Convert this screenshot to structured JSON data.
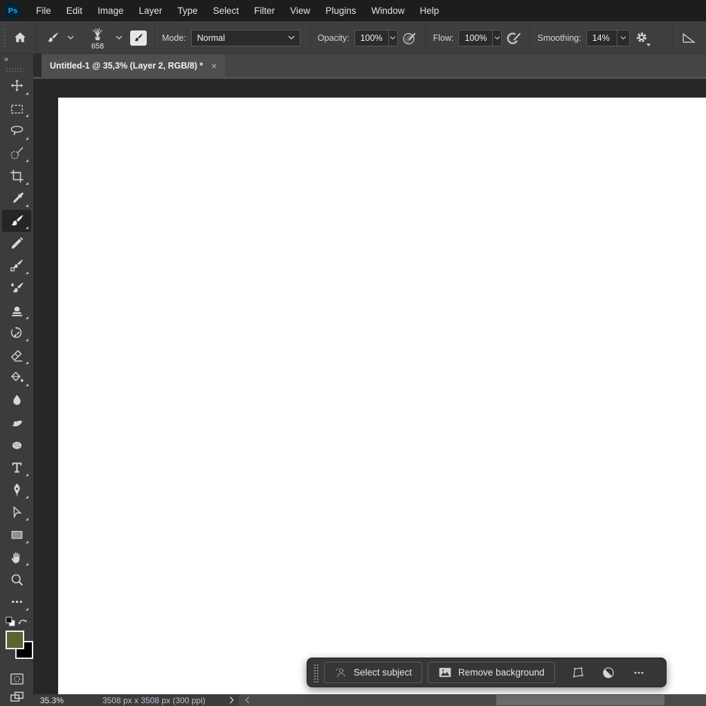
{
  "menu_bar": {
    "logo_text": "Ps",
    "items": [
      "File",
      "Edit",
      "Image",
      "Layer",
      "Type",
      "Select",
      "Filter",
      "View",
      "Plugins",
      "Window",
      "Help"
    ]
  },
  "options_bar": {
    "brush_size": "658",
    "mode_label": "Mode:",
    "mode_value": "Normal",
    "opacity_label": "Opacity:",
    "opacity_value": "100%",
    "flow_label": "Flow:",
    "flow_value": "100%",
    "smoothing_label": "Smoothing:",
    "smoothing_value": "14%",
    "icons": [
      "home-icon",
      "brush-tool-icon",
      "chevron-down-icon",
      "brush-preset-grass-icon",
      "brush-panel-toggle-icon",
      "pressure-opacity-icon",
      "airbrush-icon",
      "gear-icon",
      "brush-angle-icon"
    ]
  },
  "document_tab": {
    "title": "Untitled-1 @ 35,3% (Layer 2, RGB/8) *",
    "close_glyph": "×",
    "panel_collapse_glyph": "»"
  },
  "toolbar": {
    "selected_tool": "brush-tool",
    "tools": [
      "move-tool",
      "rectangular-marquee-tool",
      "lasso-tool",
      "selection-brush-tool",
      "crop-tool",
      "eyedropper-tool",
      "brush-tool",
      "pencil-tool",
      "color-replacement-tool",
      "mixer-brush-tool",
      "clone-stamp-tool",
      "history-brush-tool",
      "eraser-tool",
      "paint-bucket-tool",
      "blur-tool",
      "smudge-tool",
      "sponge-tool",
      "type-tool",
      "pen-tool",
      "direct-selection-tool",
      "rectangle-tool",
      "hand-tool",
      "zoom-tool",
      "edit-toolbar"
    ]
  },
  "color_controls": {
    "foreground": "#57652f",
    "background": "#000000"
  },
  "canvas": {
    "color": "#ffffff"
  },
  "taskbar": {
    "select_subject_label": "Select subject",
    "remove_background_label": "Remove background",
    "icons": [
      "drag-handle",
      "select-subject-icon",
      "remove-background-icon",
      "transform-icon",
      "adjustment-icon",
      "more-options-icon"
    ]
  },
  "status_bar": {
    "zoom_level": "35.3%",
    "document_info": "3508 px x 3508 px (300 ppi)"
  }
}
